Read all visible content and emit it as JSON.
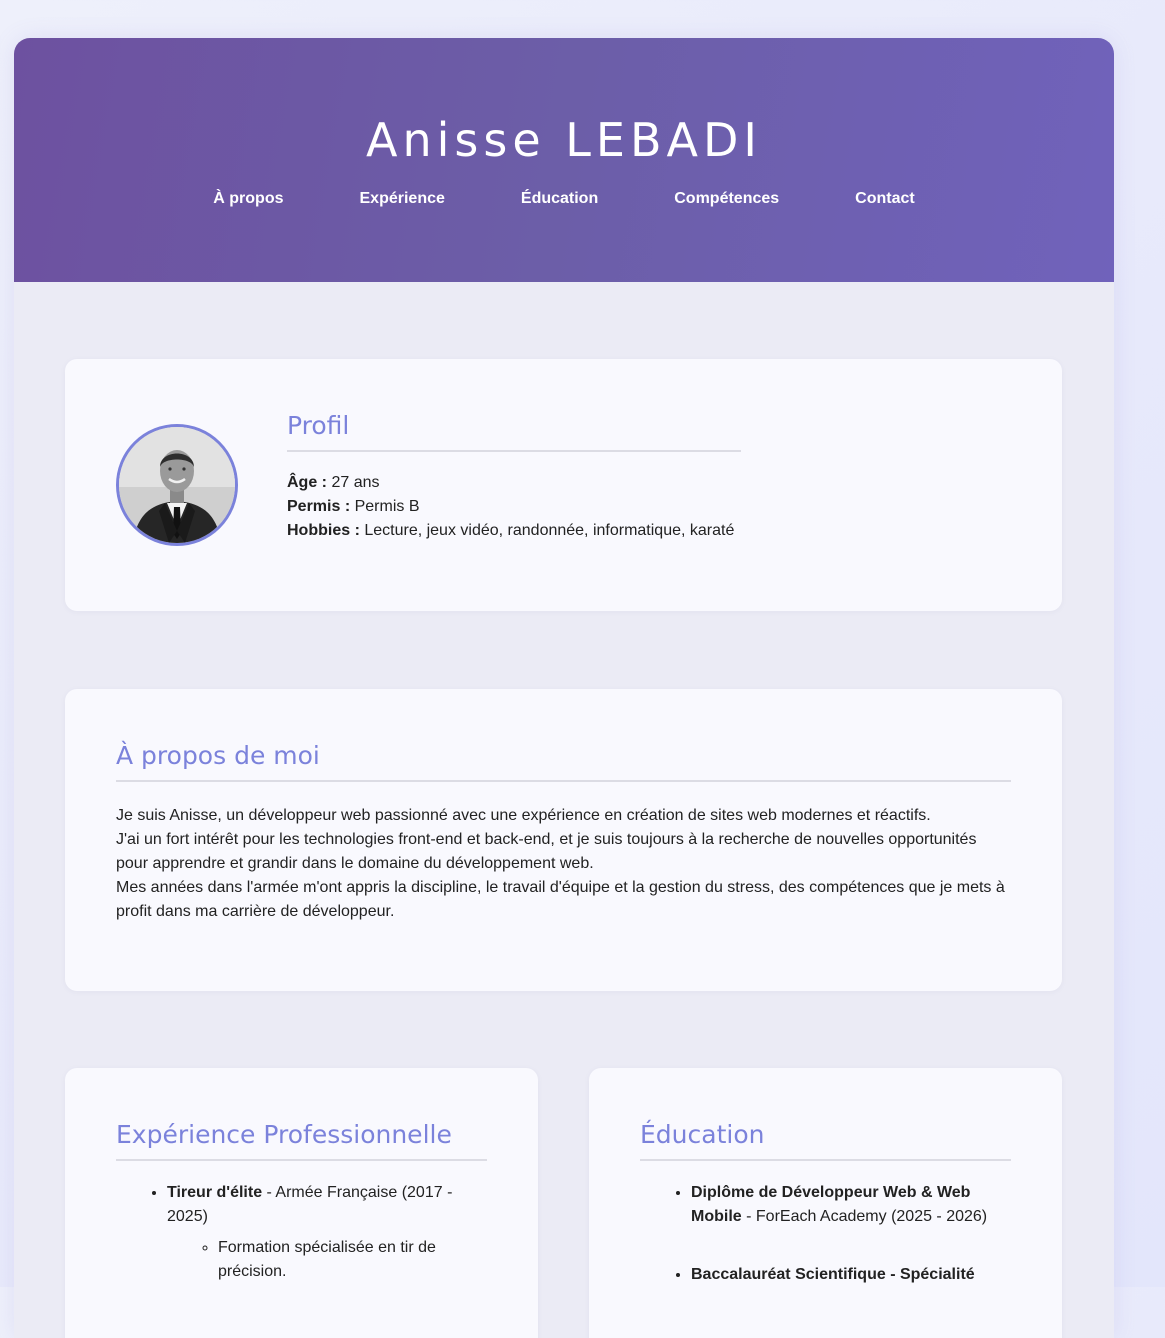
{
  "header": {
    "name": "Anisse LEBADI",
    "nav": [
      "À propos",
      "Expérience",
      "Éducation",
      "Compétences",
      "Contact"
    ]
  },
  "profile": {
    "title": "Profil",
    "age_label": "Âge :",
    "age_value": "27 ans",
    "permis_label": "Permis :",
    "permis_value": "Permis B",
    "hobbies_label": "Hobbies :",
    "hobbies_value": "Lecture, jeux vidéo, randonnée, informatique, karaté"
  },
  "about": {
    "title": "À propos de moi",
    "p1": "Je suis Anisse, un développeur web passionné avec une expérience en création de sites web modernes et réactifs.",
    "p2": "J'ai un fort intérêt pour les technologies front-end et back-end, et je suis toujours à la recherche de nouvelles opportunités pour apprendre et grandir dans le domaine du développement web.",
    "p3": "Mes années dans l'armée m'ont appris la discipline, le travail d'équipe et la gestion du stress, des compétences que je mets à profit dans ma carrière de développeur."
  },
  "experience": {
    "title": "Expérience Professionnelle",
    "items": [
      {
        "role": "Tireur d'élite",
        "detail": " - Armée Française (2017 - 2025)",
        "sub": [
          "Formation spécialisée en tir de précision."
        ]
      }
    ]
  },
  "education": {
    "title": "Éducation",
    "items": [
      {
        "degree": "Diplôme de Développeur Web & Web Mobile",
        "detail": " - ForEach Academy (2025 - 2026)"
      },
      {
        "degree": "Baccalauréat Scientifique - Spécialité",
        "detail": ""
      }
    ]
  },
  "colors": {
    "header_start": "#6d51a0",
    "header_end": "#7062bb",
    "accent": "#7b82db",
    "card_bg": "#f9f9fe",
    "page_bg": "#ebebf5"
  }
}
